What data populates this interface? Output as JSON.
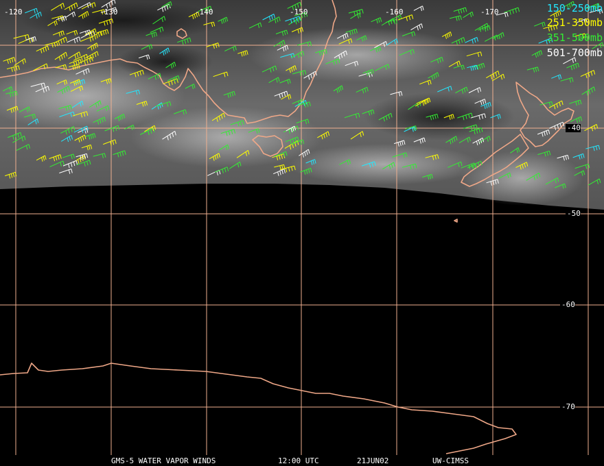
{
  "map": {
    "longitude_labels": [
      "-120",
      "-130",
      "-140",
      "-150",
      "-160",
      "-170"
    ],
    "latitude_labels": [
      "-40",
      "-50",
      "-60",
      "-70"
    ],
    "colors": {
      "grid": "#f0b090",
      "coastline": "#f0a888",
      "background": "#000000"
    }
  },
  "legend": [
    {
      "label": "150-250mb",
      "color": "#22e8ff"
    },
    {
      "label": "251-350mb",
      "color": "#ffff00"
    },
    {
      "label": "351-500mb",
      "color": "#33ee33"
    },
    {
      "label": "501-700mb",
      "color": "#ffffff"
    }
  ],
  "footer": {
    "product": "GMS-5 WATER VAPOR WINDS",
    "time": "12:00 UTC",
    "date": "21JUN02",
    "source": "UW-CIMSS"
  }
}
